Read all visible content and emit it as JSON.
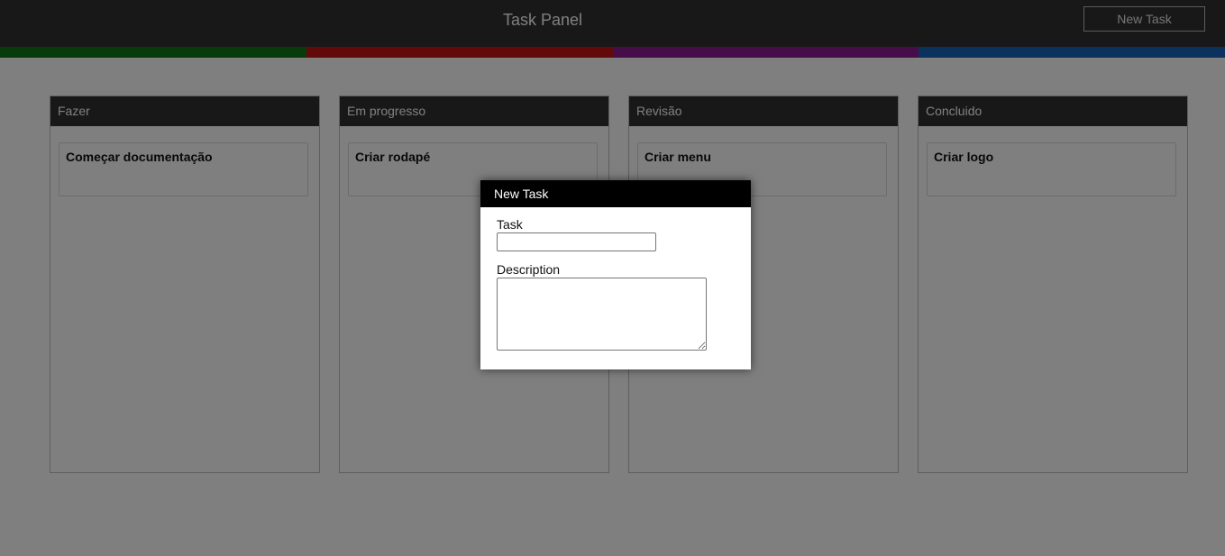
{
  "header": {
    "title": "Task Panel",
    "new_task_label": "New Task"
  },
  "stripes": [
    {
      "color": "#137413"
    },
    {
      "color": "#c41414"
    },
    {
      "color": "#8c1a90"
    },
    {
      "color": "#1565ba"
    }
  ],
  "columns": [
    {
      "title": "Fazer",
      "cards": [
        {
          "title": "Começar documentação"
        }
      ]
    },
    {
      "title": "Em progresso",
      "cards": [
        {
          "title": "Criar rodapé"
        }
      ]
    },
    {
      "title": "Revisão",
      "cards": [
        {
          "title": "Criar menu"
        }
      ]
    },
    {
      "title": "Concluido",
      "cards": [
        {
          "title": "Criar logo"
        }
      ]
    }
  ],
  "modal": {
    "title": "New Task",
    "task_label": "Task",
    "task_value": "",
    "description_label": "Description",
    "description_value": ""
  },
  "colors": {
    "header_bg": "#333133",
    "overlay": "rgba(0,0,0,0.5)",
    "modal_header_bg": "#000000"
  }
}
